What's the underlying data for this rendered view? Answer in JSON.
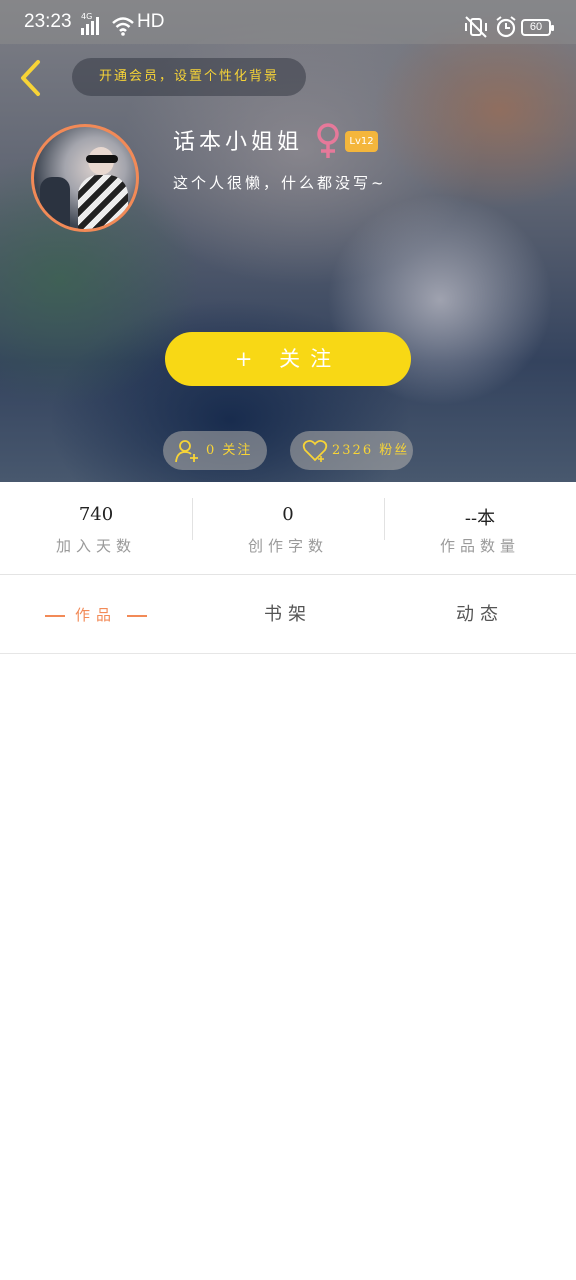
{
  "status_bar": {
    "time": "23:23",
    "network": "4G",
    "hd": "HD",
    "battery": "60"
  },
  "header": {
    "vip_prompt": "开通会员，设置个性化背景",
    "username": "话本小姐姐",
    "level": "Lv12",
    "bio": "这个人很懒，什么都没写~",
    "follow_label": "+ 关注",
    "following_text": "0 关注",
    "fans_text": "2326 粉丝",
    "accent_color": "#f8d815"
  },
  "stats": [
    {
      "value": "740",
      "label": "加入天数"
    },
    {
      "value": "0",
      "label": "创作字数"
    },
    {
      "value": "--本",
      "label": "作品数量"
    }
  ],
  "tabs": [
    {
      "label": "作品",
      "active": true
    },
    {
      "label": "书架",
      "active": false
    },
    {
      "label": "动态",
      "active": false
    }
  ],
  "colors": {
    "active_tab": "#f28a57",
    "badge": "#f4b63c",
    "gender_icon": "#e6799a"
  }
}
